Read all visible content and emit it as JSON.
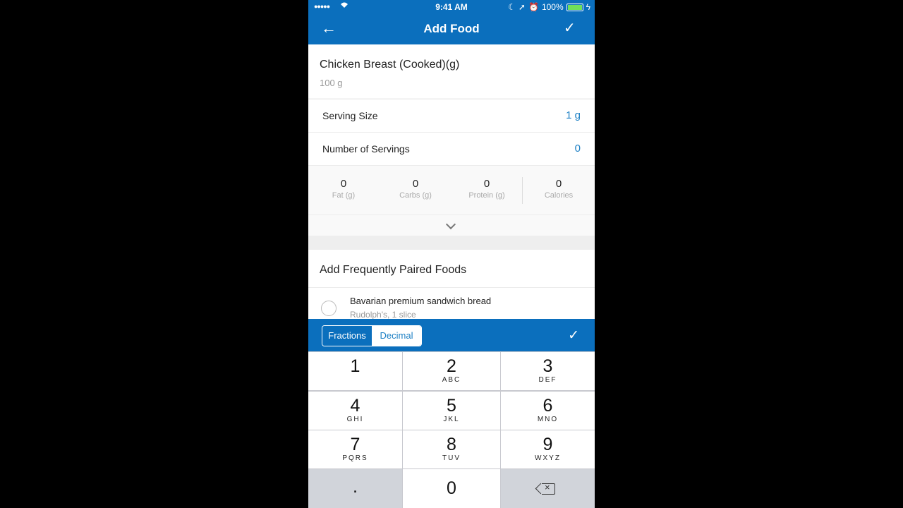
{
  "status_bar": {
    "time": "9:41 AM",
    "battery": "100%",
    "signal": "●●●●●"
  },
  "nav": {
    "title": "Add Food",
    "back_icon": "arrow-left-icon",
    "confirm_icon": "checkmark-icon"
  },
  "food": {
    "name": "Chicken Breast (Cooked)(g)",
    "serving_desc": "100 g"
  },
  "serving_size": {
    "label": "Serving Size",
    "value": "1 g"
  },
  "servings": {
    "label": "Number of Servings",
    "value": "0"
  },
  "macros": [
    {
      "value": "0",
      "label": "Fat (g)"
    },
    {
      "value": "0",
      "label": "Carbs (g)"
    },
    {
      "value": "0",
      "label": "Protein (g)"
    },
    {
      "value": "0",
      "label": "Calories"
    }
  ],
  "paired": {
    "title": "Add Frequently Paired Foods",
    "items": [
      {
        "name": "Bavarian premium sandwich bread",
        "detail": "Rudolph's, 1 slice"
      }
    ]
  },
  "accessory": {
    "fractions": "Fractions",
    "decimal": "Decimal",
    "selected": "Fractions"
  },
  "keypad": {
    "keys": [
      {
        "num": "1",
        "letters": ""
      },
      {
        "num": "2",
        "letters": "ABC"
      },
      {
        "num": "3",
        "letters": "DEF"
      },
      {
        "num": "4",
        "letters": "GHI"
      },
      {
        "num": "5",
        "letters": "JKL"
      },
      {
        "num": "6",
        "letters": "MNO"
      },
      {
        "num": "7",
        "letters": "PQRS"
      },
      {
        "num": "8",
        "letters": "TUV"
      },
      {
        "num": "9",
        "letters": "WXYZ"
      }
    ],
    "dot": ".",
    "zero": "0"
  },
  "colors": {
    "brand": "#0b6fbd",
    "accent": "#1b7fc4"
  }
}
